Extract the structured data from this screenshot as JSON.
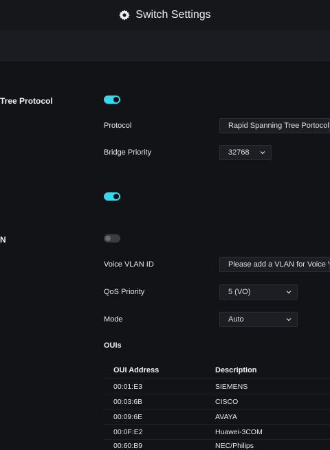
{
  "header": {
    "title": "Switch Settings",
    "icon": "gear-icon"
  },
  "stp": {
    "label": "Tree Protocol",
    "enabled": true,
    "protocol_label": "Protocol",
    "protocol_value": "Rapid Spanning Tree Portocol",
    "bridge_priority_label": "Bridge Priority",
    "bridge_priority_value": "32768"
  },
  "feature2": {
    "enabled": true
  },
  "voice_vlan": {
    "label": "N",
    "enabled": false,
    "vlan_id_label": "Voice VLAN ID",
    "vlan_id_value": "Please add a VLAN for Voice V",
    "qos_label": "QoS Priority",
    "qos_value": "5 (VO)",
    "mode_label": "Mode",
    "mode_value": "Auto",
    "ouis_label": "OUIs",
    "table": {
      "headers": {
        "address": "OUI Address",
        "description": "Description"
      },
      "rows": [
        {
          "address": "00:01:E3",
          "description": "SIEMENS"
        },
        {
          "address": "00:03:6B",
          "description": "CISCO"
        },
        {
          "address": "00:09:6E",
          "description": "AVAYA"
        },
        {
          "address": "00:0F:E2",
          "description": "Huawei-3COM"
        },
        {
          "address": "00:60:B9",
          "description": "NEC/Philips"
        }
      ]
    }
  },
  "colors": {
    "accent": "#36d8ec",
    "background": "#121317"
  }
}
